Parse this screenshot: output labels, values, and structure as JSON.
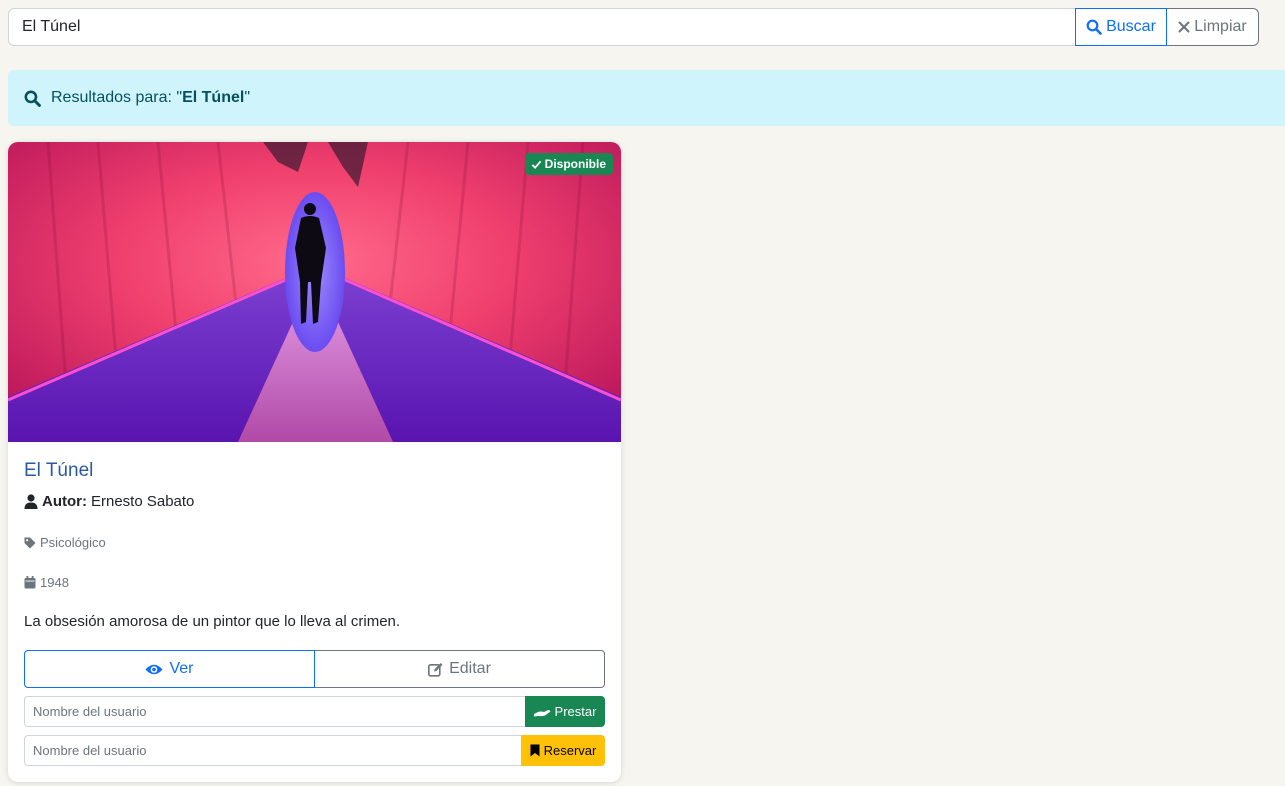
{
  "search": {
    "value": "El Túnel",
    "search_button": "Buscar",
    "clear_button": "Limpiar"
  },
  "results_alert": {
    "prefix": "Resultados para: \"",
    "query": "El Túnel",
    "suffix": "\""
  },
  "book": {
    "status_badge": "Disponible",
    "title": "El Túnel",
    "author_label": "Autor:",
    "author": "Ernesto Sabato",
    "genre": "Psicológico",
    "year": "1948",
    "description": "La obsesión amorosa de un pintor que lo lleva al crimen.",
    "view_button": "Ver",
    "edit_button": "Editar",
    "lend_placeholder": "Nombre del usuario",
    "lend_button": "Prestar",
    "reserve_placeholder": "Nombre del usuario",
    "reserve_button": "Reservar"
  },
  "colors": {
    "primary": "#0d6efd",
    "success": "#198754",
    "warning": "#ffc107",
    "info_bg": "#cff4fc",
    "title": "#2c5aa0"
  },
  "icons": [
    "search-icon",
    "close-icon",
    "check-icon",
    "user-icon",
    "tag-icon",
    "calendar-icon",
    "eye-icon",
    "edit-icon",
    "hand-icon",
    "bookmark-icon"
  ]
}
